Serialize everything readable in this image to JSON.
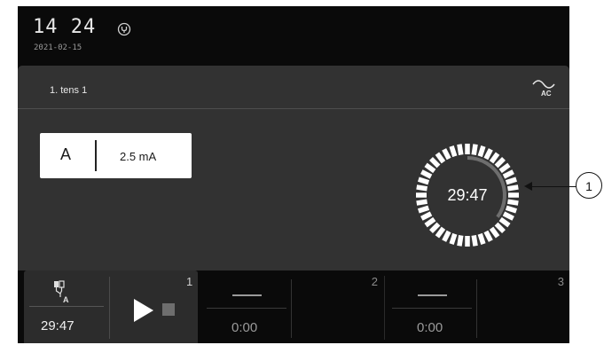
{
  "header": {
    "time": "14 24",
    "date": "2021-02-15",
    "status_icon": "power-plug-icon"
  },
  "program": {
    "name": "1. tens 1",
    "waveform_icon": "ac-wave-icon",
    "waveform_label": "AC"
  },
  "channel": {
    "letter": "A",
    "amplitude": "2.5 mA"
  },
  "timer": {
    "remaining": "29:47",
    "progress_fraction": 0.35
  },
  "slots": [
    {
      "number": "1",
      "electrode_label": "A",
      "time": "29:47",
      "active": true
    },
    {
      "number": "2",
      "dash": "—",
      "time": "0:00",
      "active": false
    },
    {
      "number": "3",
      "dash": "—",
      "time": "0:00",
      "active": false
    }
  ],
  "callout": {
    "number": "1"
  },
  "colors": {
    "screen_bg": "#0a0a0a",
    "panel_bg": "#323232",
    "ring_segment": "#ffffff",
    "ring_progress": "#6e6e6e"
  }
}
